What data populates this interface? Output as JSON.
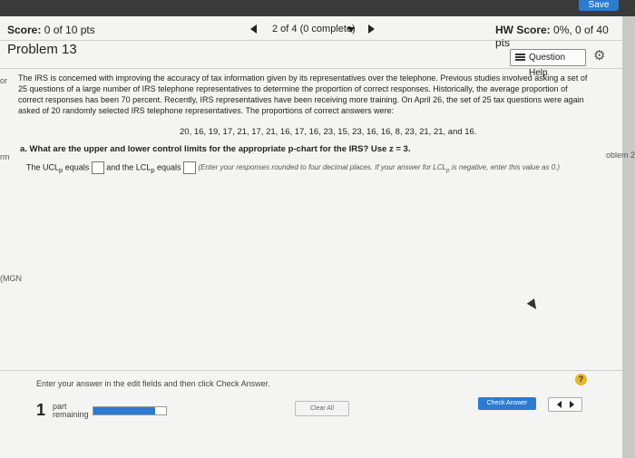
{
  "topbar": {
    "save_label": "Save"
  },
  "header": {
    "score_label": "Score:",
    "score_value": "0 of 10 pts",
    "nav_text": "2 of 4 (0 complete)",
    "hw_label": "HW Score:",
    "hw_value": "0%, 0 of 40 pts"
  },
  "problem": {
    "title": "Problem 13",
    "help_label": "Question Help",
    "paragraph": "The IRS is concerned with improving the accuracy of tax information given by its representatives over the telephone. Previous studies involved asking a set of 25 questions of a large number of IRS telephone representatives to determine the proportion of correct responses. Historically, the average proportion of correct responses has been 70 percent. Recently, IRS representatives have been receiving more training. On April 26, the set of 25 tax questions were again asked of 20 randomly selected IRS telephone representatives. The proportions of correct answers were:",
    "data_line": "20, 16, 19, 17, 21, 17, 21, 16, 17, 16, 23, 15, 23, 16, 16, 8, 23, 21, 21, and 16.",
    "question_a": "a. What are the upper and lower control limits for the appropriate p-chart for the IRS? Use z = 3.",
    "ucl_prefix": "The UCL",
    "ucl_sub": "p",
    "ucl_mid": " equals ",
    "lcl_prefix": " and the LCL",
    "lcl_sub": "p",
    "lcl_mid": " equals ",
    "note": "(Enter your responses rounded to four decimal places. If your answer for LCL",
    "note_sub": "p",
    "note_end": " is negative, enter this value as 0.)"
  },
  "sidebar_fragments": {
    "left_top": "or",
    "left_mid": "rm",
    "left_low": "(MGN",
    "right_mid": "oblem 2"
  },
  "footer": {
    "instruction": "Enter your answer in the edit fields and then click Check Answer.",
    "help_icon": "?",
    "parts_number": "1",
    "parts_line1": "part",
    "parts_line2": "remaining",
    "progress": 0.85,
    "clear_label": "Clear All",
    "check_label": "Check Answer"
  }
}
